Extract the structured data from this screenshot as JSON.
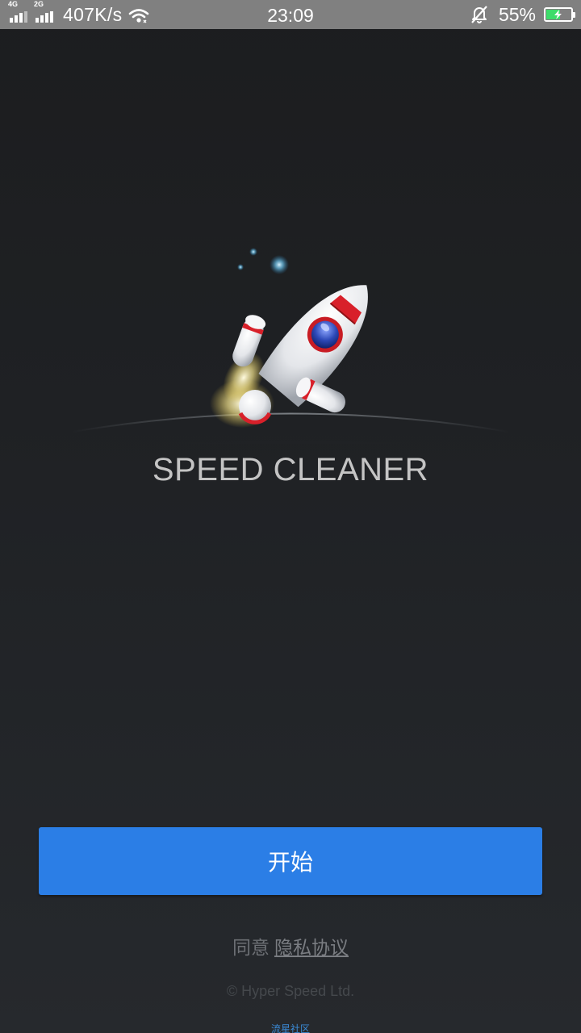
{
  "status_bar": {
    "network1": "4G",
    "network2": "2G",
    "speed": "407K/s",
    "time": "23:09",
    "battery_percent": "55%",
    "battery_level": 0.55,
    "icons": [
      "signal-icon",
      "wifi-icon",
      "mute-icon",
      "battery-charging-icon"
    ]
  },
  "splash": {
    "app_name": "SPEED CLEANER",
    "logo_icon": "rocket-icon"
  },
  "actions": {
    "start_label": "开始"
  },
  "footer": {
    "agree_prefix": "同意",
    "privacy_link": "隐私协议",
    "copyright": "© Hyper Speed Ltd.",
    "watermark": "流星社区"
  },
  "colors": {
    "accent": "#2b7ee6",
    "statusbar": "#808080",
    "background": "#1f2124",
    "rocket_stripe": "#d8202a"
  }
}
